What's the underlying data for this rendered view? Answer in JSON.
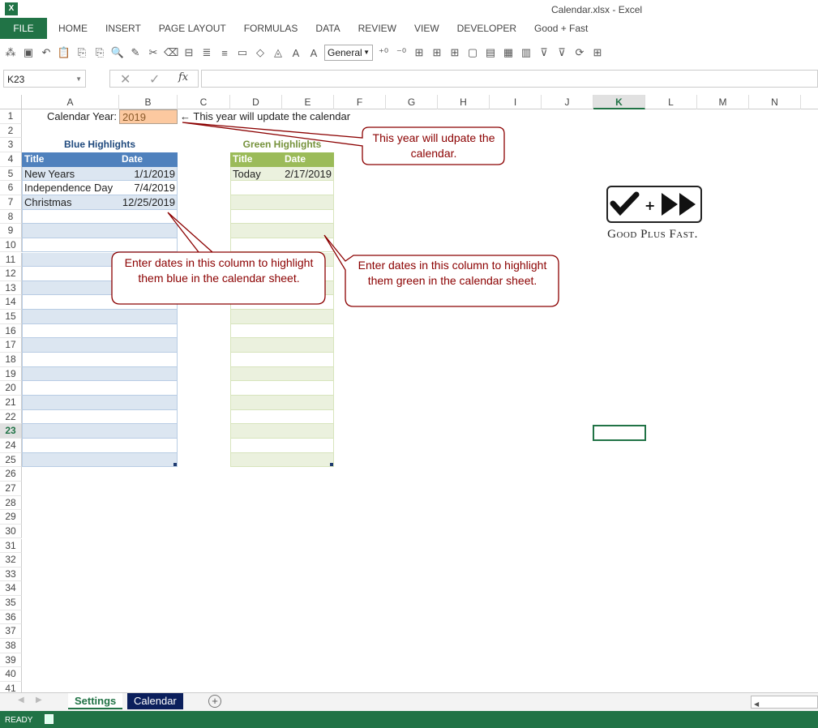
{
  "window": {
    "title": "Calendar.xlsx - Excel",
    "app_icon": "X"
  },
  "ribbon": {
    "tabs": [
      "FILE",
      "HOME",
      "INSERT",
      "PAGE LAYOUT",
      "FORMULAS",
      "DATA",
      "REVIEW",
      "VIEW",
      "DEVELOPER",
      "Good + Fast"
    ]
  },
  "toolbar": {
    "number_format": "General",
    "icons": [
      "org-chart-icon",
      "save-icon",
      "undo-icon",
      "paste-icon",
      "copy-icon",
      "copy-format-icon",
      "print-preview-icon",
      "format-painter-icon",
      "clear-format-icon",
      "eraser-icon",
      "merge-icon",
      "wrap-text-icon",
      "align-icon",
      "textbox-icon",
      "shapes-icon",
      "fill-color-icon",
      "font-color-icon",
      "text-style-icon"
    ],
    "icons2": [
      "increase-decimal-icon",
      "decrease-decimal-icon",
      "borders-icon",
      "all-borders-icon",
      "inner-borders-icon",
      "outer-borders-icon",
      "conditional-format-icon",
      "table-icon",
      "sort-icon",
      "filter-icon",
      "clear-filter-icon",
      "reapply-icon",
      "insert-cells-icon"
    ]
  },
  "formula_bar": {
    "name_box": "K23",
    "formula": ""
  },
  "columns": [
    "A",
    "B",
    "C",
    "D",
    "E",
    "F",
    "G",
    "H",
    "I",
    "J",
    "K",
    "L",
    "M",
    "N"
  ],
  "selected_cell": {
    "col": "K",
    "row": 23
  },
  "cells": {
    "calendar_year_label": "Calendar Year:",
    "calendar_year_value": "2019",
    "year_note": "← This year will update the calendar",
    "blue_title": "Blue Highlights",
    "green_title": "Green Highlights",
    "blue_headers": [
      "Title",
      "Date"
    ],
    "green_headers": [
      "Title",
      "Date"
    ],
    "blue_rows": [
      [
        "New Years",
        "1/1/2019"
      ],
      [
        "Independence Day",
        "7/4/2019"
      ],
      [
        "Christmas",
        "12/25/2019"
      ]
    ],
    "green_rows": [
      [
        "Today",
        "2/17/2019"
      ]
    ]
  },
  "callouts": [
    "This year will udpate the calendar.",
    "Enter dates in this column to highlight them blue in the calendar sheet.",
    "Enter dates in this column to highlight them green in the calendar sheet."
  ],
  "logo": {
    "text": "Good Plus Fast."
  },
  "sheet_tabs": [
    "Settings",
    "Calendar"
  ],
  "status": {
    "text": "READY"
  },
  "colors": {
    "excel_green": "#217346",
    "blue_header": "#4F81BD",
    "blue_band": "#DCE6F1",
    "green_header": "#9BBB59",
    "green_band": "#EBF1DE",
    "input_orange": "#FCC9A0",
    "callout_red": "#8B0000"
  }
}
